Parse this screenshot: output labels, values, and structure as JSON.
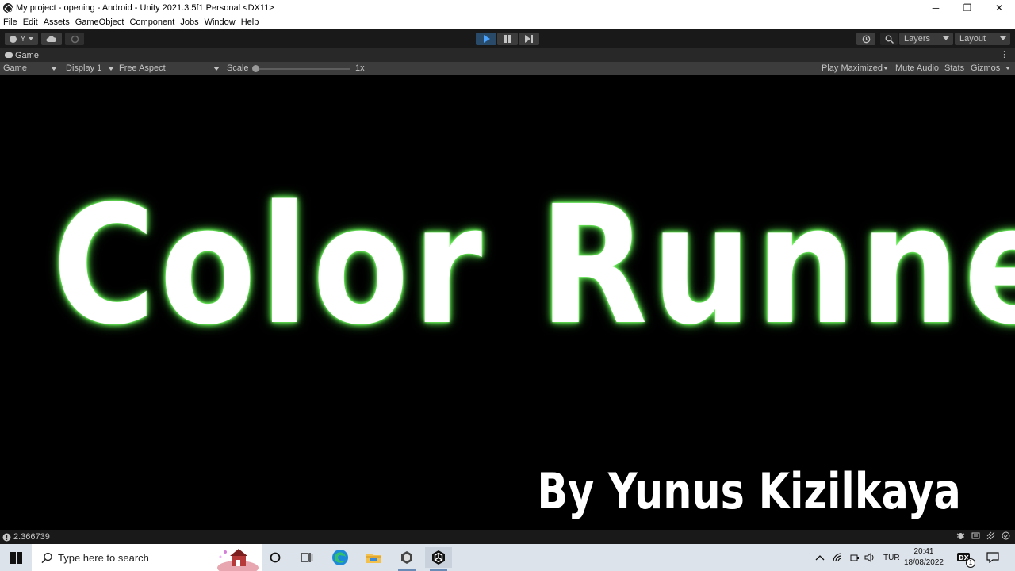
{
  "window": {
    "title": "My project - opening - Android - Unity 2021.3.5f1 Personal <DX11>",
    "minimize": "─",
    "maximize": "❐",
    "close": "✕"
  },
  "menu": [
    "File",
    "Edit",
    "Assets",
    "GameObject",
    "Component",
    "Jobs",
    "Window",
    "Help"
  ],
  "toolbar": {
    "account_label": "Y",
    "layers_label": "Layers",
    "layout_label": "Layout"
  },
  "tab": {
    "label": "Game",
    "menu": "⋮"
  },
  "gamebar": {
    "view_label": "Game",
    "display_label": "Display 1",
    "aspect_label": "Free Aspect",
    "scale_label": "Scale",
    "scale_value": "1x",
    "play_maximized": "Play Maximized",
    "mute_audio": "Mute Audio",
    "stats": "Stats",
    "gizmos": "Gizmos"
  },
  "game": {
    "title": "Color Runner",
    "author": "By Yunus Kizilkaya"
  },
  "status": {
    "message": "2.366739"
  },
  "taskbar": {
    "search_placeholder": "Type here to search",
    "language": "TUR",
    "time": "20:41",
    "date": "18/08/2022",
    "notification_count": "1"
  },
  "colors": {
    "glow": "#6ef55c",
    "editor_dark": "#191919",
    "play_active": "#2a4a6a",
    "taskbar": "#dde3ea"
  }
}
